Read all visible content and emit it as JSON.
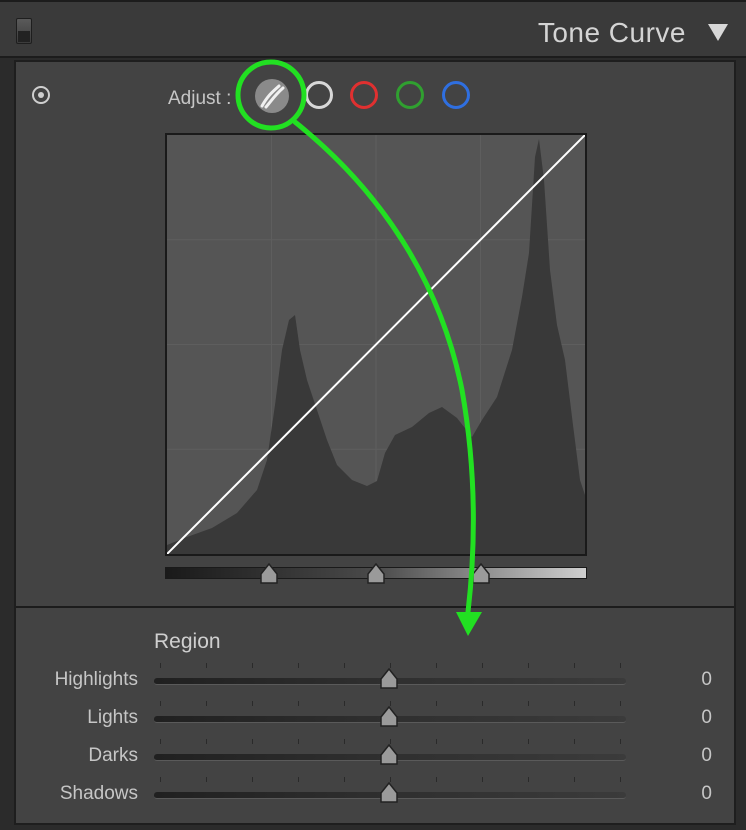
{
  "panel": {
    "title": "Tone Curve"
  },
  "adjust": {
    "label": "Adjust :"
  },
  "channels": [
    {
      "name": "parametric",
      "color": "#8a8a8a"
    },
    {
      "name": "point-rgb",
      "color": "#d8d8d8"
    },
    {
      "name": "red",
      "color": "#e03030"
    },
    {
      "name": "green",
      "color": "#30a030"
    },
    {
      "name": "blue",
      "color": "#2f6fe0"
    }
  ],
  "region": {
    "label": "Region",
    "sliders": [
      {
        "label": "Highlights",
        "value": "0"
      },
      {
        "label": "Lights",
        "value": "0"
      },
      {
        "label": "Darks",
        "value": "0"
      },
      {
        "label": "Shadows",
        "value": "0"
      }
    ]
  },
  "split_points": [
    0.25,
    0.5,
    0.75
  ],
  "colors": {
    "annotation": "#22e022",
    "curve": "#ffffff",
    "histogram": "#393939"
  }
}
